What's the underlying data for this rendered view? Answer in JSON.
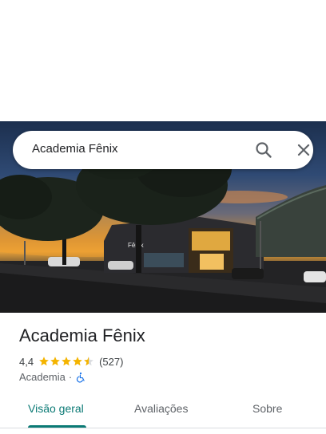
{
  "search": {
    "query": "Academia Fênix",
    "icons": [
      "search-icon",
      "close-icon"
    ]
  },
  "hero": {
    "sign_text": "Fênix"
  },
  "place": {
    "name": "Academia Fênix",
    "rating": "4,4",
    "stars": 4.4,
    "reviews": "(527)",
    "category": "Academia",
    "separator": "·",
    "accessibility_icon": "wheelchair-icon"
  },
  "tabs": [
    {
      "label": "Visão geral",
      "active": true
    },
    {
      "label": "Avaliações",
      "active": false
    },
    {
      "label": "Sobre",
      "active": false
    }
  ],
  "colors": {
    "accent": "#0b7a75",
    "star": "#f4b400",
    "accessibility": "#1a73e8"
  }
}
